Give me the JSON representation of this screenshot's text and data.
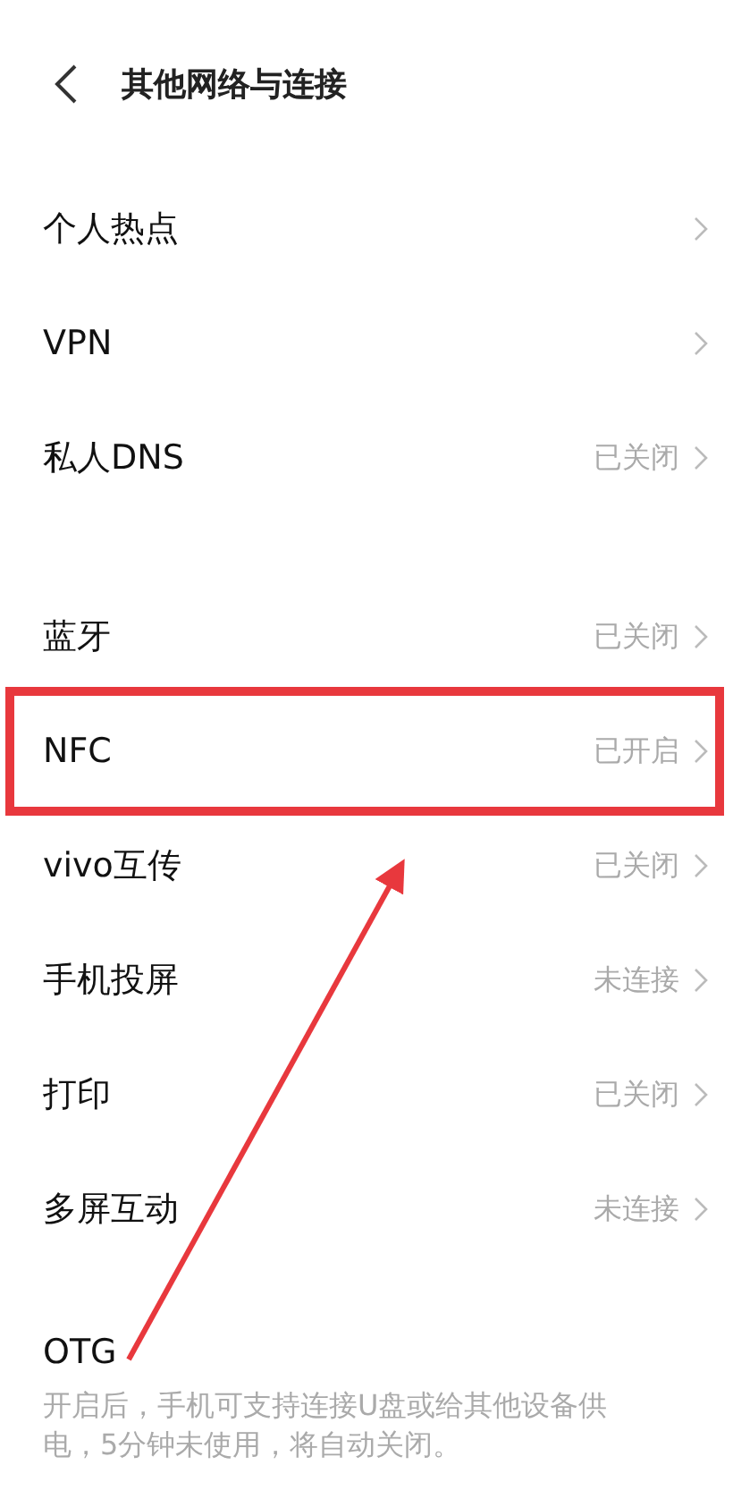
{
  "header": {
    "title": "其他网络与连接"
  },
  "sections": [
    {
      "items": [
        {
          "label": "个人热点",
          "highlighted": false
        },
        {
          "label": "VPN",
          "highlighted": false
        },
        {
          "label": "私人DNS",
          "status": "已关闭",
          "highlighted": false
        }
      ]
    },
    {
      "items": [
        {
          "label": "蓝牙",
          "status": "已关闭",
          "highlighted": false
        },
        {
          "label": "NFC",
          "status": "已开启",
          "highlighted": true
        },
        {
          "label": "vivo互传",
          "status": "已关闭",
          "highlighted": false
        },
        {
          "label": "手机投屏",
          "status": "未连接",
          "highlighted": false
        },
        {
          "label": "打印",
          "status": "已关闭",
          "highlighted": false
        },
        {
          "label": "多屏互动",
          "status": "未连接",
          "highlighted": false
        }
      ]
    }
  ],
  "otg": {
    "title": "OTG",
    "description": "开启后，手机可支持连接U盘或给其他设备供电，5分钟未使用，将自动关闭。"
  }
}
